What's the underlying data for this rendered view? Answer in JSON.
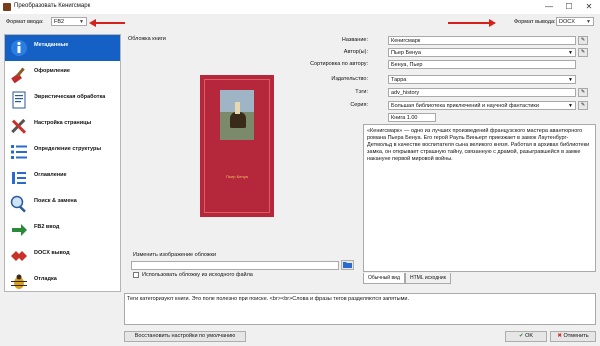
{
  "window": {
    "title": "Преобразовать Кенигсмарк",
    "minimize": "—",
    "maximize": "☐",
    "close": "✕"
  },
  "top": {
    "input_format_label": "Формат ввода:",
    "input_format_value": "FB2",
    "output_format_label": "Формат вывода:",
    "output_format_value": "DOCX"
  },
  "sidebar": {
    "items": [
      {
        "label": "Метаданные",
        "icon": "info-icon"
      },
      {
        "label": "Оформление",
        "icon": "paintbrush-icon"
      },
      {
        "label": "Эвристическая обработка",
        "icon": "document-icon"
      },
      {
        "label": "Настройка страницы",
        "icon": "wrench-icon"
      },
      {
        "label": "Определение структуры",
        "icon": "list-icon"
      },
      {
        "label": "Оглавление",
        "icon": "toc-icon"
      },
      {
        "label": "Поиск & замена",
        "icon": "magnifier-icon"
      },
      {
        "label": "FB2 ввод",
        "icon": "arrow-icon"
      },
      {
        "label": "DOCX вывод",
        "icon": "diamond-icon"
      },
      {
        "label": "Отладка",
        "icon": "bug-icon"
      }
    ]
  },
  "cover": {
    "section_label": "Обложка книги",
    "book_caption": "Пьер Бенуа",
    "change_cover_label": "Изменить изображение обложки",
    "use_source_cover_label": "Использовать обложку из исходного файла"
  },
  "metadata": {
    "title_label": "Название:",
    "title_value": "Кенигсмарк",
    "authors_label": "Автор(ы):",
    "authors_value": "Пьер Бенуа",
    "sort_author_label": "Сортировка по автору:",
    "sort_author_value": "Бенуа, Пьер",
    "publisher_label": "Издательство:",
    "publisher_value": "Тарра",
    "tags_label": "Тэги:",
    "tags_value": "adv_history",
    "series_label": "Серия:",
    "series_value": "Большая библиотека приключений и научной фантастики",
    "book_number": "Книга 1.00",
    "comment": "«Кенигсмарк» — одно из лучших произведений французского мастера авантюрного романа Пьера Бенуа. Его герой Рауль Виньерт приезжает в замок Лаутенбург-Детмольд в качестве воспитателя сына великого князя. Работая в архивах библиотеки замка, он открывает страшную тайну, связанную с драмой, разыгравшейся в замке накануне первой мировой войны.",
    "tab_normal": "Обычный вид",
    "tab_html": "HTML исходник"
  },
  "hint_text": "Теги категоризуют книги. Это поле полезно при поиске. <br><br>Слова и фразы тегов разделяются запятыми.",
  "buttons": {
    "restore_defaults": "Восстановить настройки по умолчанию",
    "ok": "OK",
    "cancel": "Отменить"
  },
  "colors": {
    "selection": "#1560c5",
    "arrow": "#d6201c",
    "book": "#b5283c"
  }
}
